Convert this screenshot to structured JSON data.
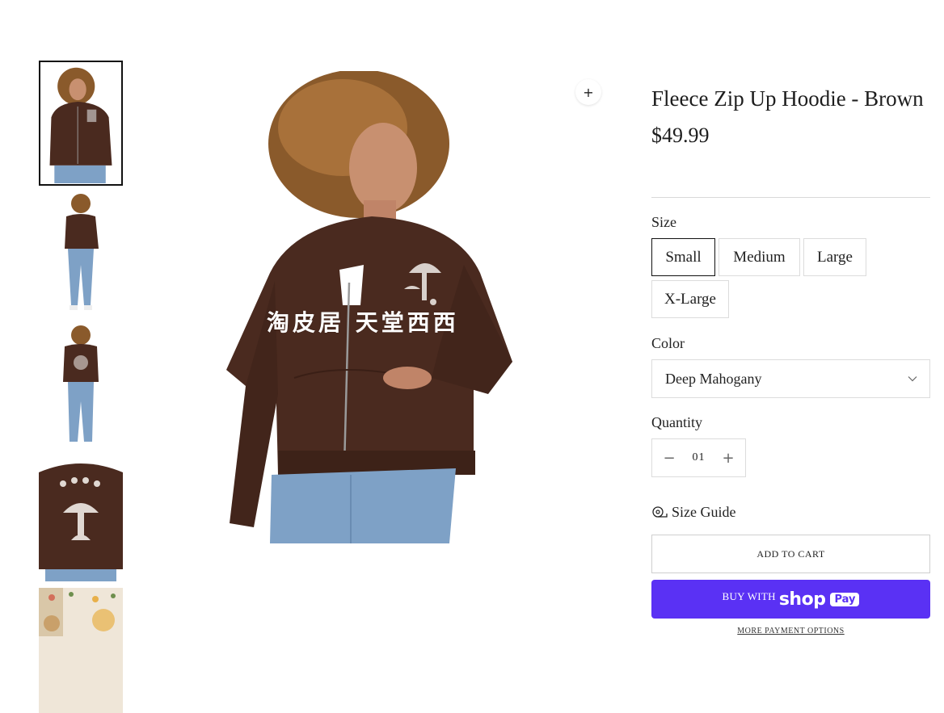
{
  "product": {
    "title": "Fleece Zip Up Hoodie - Brown",
    "price": "$49.99"
  },
  "gallery": {
    "watermark": "淘皮居 天堂西西",
    "zoom_icon": "plus-icon",
    "thumbnails": [
      {
        "name": "front-view",
        "active": true
      },
      {
        "name": "side-full-view",
        "active": false
      },
      {
        "name": "back-full-view",
        "active": false
      },
      {
        "name": "back-print-closeup",
        "active": false
      },
      {
        "name": "lifestyle-photo",
        "active": false
      }
    ]
  },
  "options": {
    "size_label": "Size",
    "sizes": [
      "Small",
      "Medium",
      "Large",
      "X-Large"
    ],
    "selected_size": "Small",
    "color_label": "Color",
    "color_value": "Deep Mahogany",
    "quantity_label": "Quantity",
    "quantity_value": "01"
  },
  "actions": {
    "size_guide": "Size Guide",
    "add_to_cart": "ADD TO CART",
    "buy_with": "BUY WITH",
    "shop_brand": "shop",
    "pay_brand": "Pay",
    "more_payment": "MORE PAYMENT OPTIONS"
  },
  "colors": {
    "shop_pay": "#5a31f4",
    "hoodie": "#4a2a1f",
    "jeans": "#7ea1c6"
  }
}
